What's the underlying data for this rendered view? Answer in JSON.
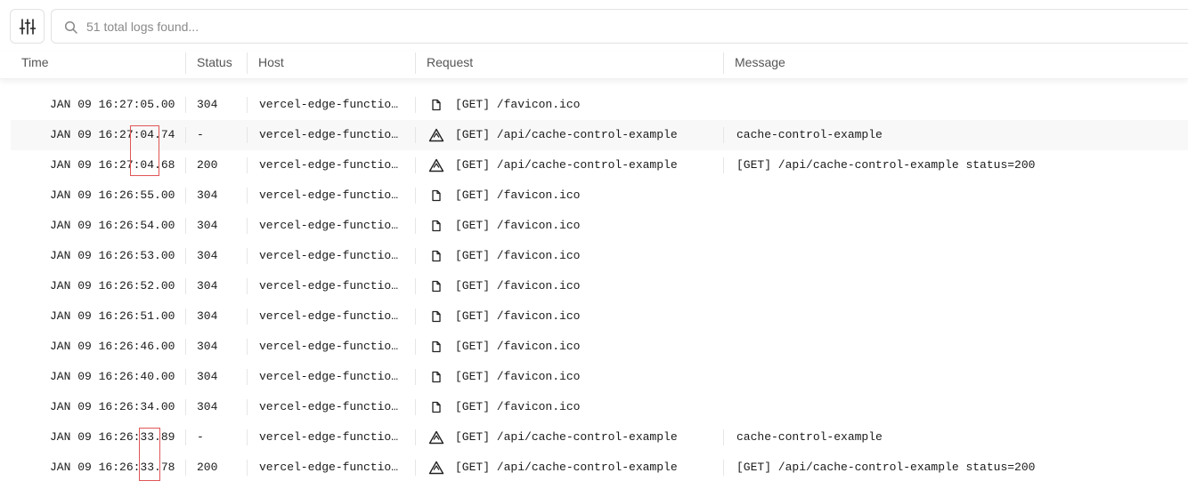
{
  "search": {
    "placeholder": "51 total logs found..."
  },
  "columns": {
    "time": "Time",
    "status": "Status",
    "host": "Host",
    "request": "Request",
    "message": "Message"
  },
  "rows": [
    {
      "time": "JAN 09 16:27:05.00",
      "status": "304",
      "host": "vercel-edge-functio…",
      "icon": "file-icon",
      "request": "[GET] /favicon.ico",
      "message": ""
    },
    {
      "time": "JAN 09 16:27:04.74",
      "status": "-",
      "host": "vercel-edge-functio…",
      "icon": "function-icon",
      "request": "[GET] /api/cache-control-example",
      "message": "cache-control-example"
    },
    {
      "time": "JAN 09 16:27:04.68",
      "status": "200",
      "host": "vercel-edge-functio…",
      "icon": "function-icon",
      "request": "[GET] /api/cache-control-example",
      "message": "[GET] /api/cache-control-example status=200"
    },
    {
      "time": "JAN 09 16:26:55.00",
      "status": "304",
      "host": "vercel-edge-functio…",
      "icon": "file-icon",
      "request": "[GET] /favicon.ico",
      "message": ""
    },
    {
      "time": "JAN 09 16:26:54.00",
      "status": "304",
      "host": "vercel-edge-functio…",
      "icon": "file-icon",
      "request": "[GET] /favicon.ico",
      "message": ""
    },
    {
      "time": "JAN 09 16:26:53.00",
      "status": "304",
      "host": "vercel-edge-functio…",
      "icon": "file-icon",
      "request": "[GET] /favicon.ico",
      "message": ""
    },
    {
      "time": "JAN 09 16:26:52.00",
      "status": "304",
      "host": "vercel-edge-functio…",
      "icon": "file-icon",
      "request": "[GET] /favicon.ico",
      "message": ""
    },
    {
      "time": "JAN 09 16:26:51.00",
      "status": "304",
      "host": "vercel-edge-functio…",
      "icon": "file-icon",
      "request": "[GET] /favicon.ico",
      "message": ""
    },
    {
      "time": "JAN 09 16:26:46.00",
      "status": "304",
      "host": "vercel-edge-functio…",
      "icon": "file-icon",
      "request": "[GET] /favicon.ico",
      "message": ""
    },
    {
      "time": "JAN 09 16:26:40.00",
      "status": "304",
      "host": "vercel-edge-functio…",
      "icon": "file-icon",
      "request": "[GET] /favicon.ico",
      "message": ""
    },
    {
      "time": "JAN 09 16:26:34.00",
      "status": "304",
      "host": "vercel-edge-functio…",
      "icon": "file-icon",
      "request": "[GET] /favicon.ico",
      "message": ""
    },
    {
      "time": "JAN 09 16:26:33.89",
      "status": "-",
      "host": "vercel-edge-functio…",
      "icon": "function-icon",
      "request": "[GET] /api/cache-control-example",
      "message": "cache-control-example"
    },
    {
      "time": "JAN 09 16:26:33.78",
      "status": "200",
      "host": "vercel-edge-functio…",
      "icon": "function-icon",
      "request": "[GET] /api/cache-control-example",
      "message": "[GET] /api/cache-control-example status=200"
    }
  ]
}
